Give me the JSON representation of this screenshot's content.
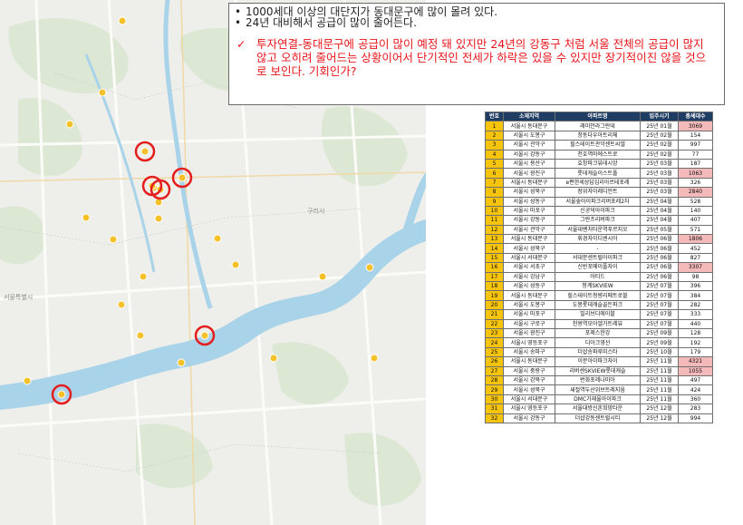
{
  "map": {
    "labels": {
      "seoul": "서울특별시",
      "guri": "구리시"
    },
    "dot_color": "#f5c12a",
    "highlight_ring_color": "#e41e1e",
    "river_color": "#a9d3e9"
  },
  "notes": {
    "bullets": [
      "1000세대 이상의 대단지가 동대문구에 많이 몰려 있다.",
      "24년 대비해서 공급이 많이 줄어든다."
    ],
    "insight": "투자연결-동대문구에 공급이 많이 예정 돼 있지만 24년의 강동구 처럼 서울 전체의 공급이 많지 않고 오히려 줄어드는 상황이어서 단기적인 전세가 하락은 있을 수 있지만 장기적이진 않을 것으로 보인다. 기회인가?",
    "insight_color": "#e8151b"
  },
  "table": {
    "columns": [
      "번호",
      "소재지역",
      "아파트명",
      "입주시기",
      "총세대수"
    ],
    "header_color": "#1f3d63",
    "number_color": "#f6c40c",
    "highlight_color": "#f4b9b9",
    "rows": [
      {
        "no": "1",
        "region": "서울시 동대문구",
        "name": "래미안라그란데",
        "date": "25년 01월",
        "units": "3069",
        "hl": true
      },
      {
        "no": "2",
        "region": "서울시 도봉구",
        "name": "창동다우아트리체",
        "date": "25년 02월",
        "units": "154",
        "hl": false
      },
      {
        "no": "3",
        "region": "서울시 관악구",
        "name": "힐스테이트관악센트씨엘",
        "date": "25년 02월",
        "units": "997",
        "hl": false
      },
      {
        "no": "4",
        "region": "서울시 강동구",
        "name": "천호역마에스트로",
        "date": "25년 02월",
        "units": "77",
        "hl": false
      },
      {
        "no": "5",
        "region": "서울시 용산구",
        "name": "효창파크뷰데시앙",
        "date": "25년 03월",
        "units": "187",
        "hl": false
      },
      {
        "no": "6",
        "region": "서울시 광진구",
        "name": "롯데캐슬이스트폴",
        "date": "25년 03월",
        "units": "1063",
        "hl": true
      },
      {
        "no": "7",
        "region": "서울시 동대문구",
        "name": "e편한세상답십리아르테포레",
        "date": "25년 03월",
        "units": "326",
        "hl": false
      },
      {
        "no": "8",
        "region": "서울시 성북구",
        "name": "장위자이레디언트",
        "date": "25년 03월",
        "units": "2840",
        "hl": true
      },
      {
        "no": "9",
        "region": "서울시 성동구",
        "name": "서울숲아이파크리버포레2차",
        "date": "25년 04월",
        "units": "528",
        "hl": false
      },
      {
        "no": "10",
        "region": "서울시 마포구",
        "name": "신공덕아이파크",
        "date": "25년 04월",
        "units": "140",
        "hl": false
      },
      {
        "no": "11",
        "region": "서울시 강동구",
        "name": "그란츠리버파크",
        "date": "25년 04월",
        "units": "407",
        "hl": false
      },
      {
        "no": "12",
        "region": "서울시 관악구",
        "name": "서울대벤처타운역푸르지오",
        "date": "25년 05월",
        "units": "571",
        "hl": false
      },
      {
        "no": "13",
        "region": "서울시 동대문구",
        "name": "휘경자이디센시아",
        "date": "25년 06월",
        "units": "1806",
        "hl": true
      },
      {
        "no": "14",
        "region": "서울시 성북구",
        "name": "-",
        "date": "25년 06월",
        "units": "452",
        "hl": false
      },
      {
        "no": "15",
        "region": "서울시 서대문구",
        "name": "서대문센트럴아이파크",
        "date": "25년 06월",
        "units": "827",
        "hl": false
      },
      {
        "no": "16",
        "region": "서울시 서초구",
        "name": "신반포메이플자이",
        "date": "25년 06월",
        "units": "3307",
        "hl": true
      },
      {
        "no": "17",
        "region": "서울시 강남구",
        "name": "아티드",
        "date": "25년 06월",
        "units": "98",
        "hl": false
      },
      {
        "no": "18",
        "region": "서울시 성동구",
        "name": "청계SKVIEW",
        "date": "25년 07월",
        "units": "396",
        "hl": false
      },
      {
        "no": "19",
        "region": "서울시 동대문구",
        "name": "힐스테이트청량리메트로블",
        "date": "25년 07월",
        "units": "384",
        "hl": false
      },
      {
        "no": "20",
        "region": "서울시 도봉구",
        "name": "도봉롯데캐슬골든파크",
        "date": "25년 07월",
        "units": "282",
        "hl": false
      },
      {
        "no": "21",
        "region": "서울시 마포구",
        "name": "빌리브디에이블",
        "date": "25년 07월",
        "units": "333",
        "hl": false
      },
      {
        "no": "22",
        "region": "서울시 구로구",
        "name": "천왕역모아엘가트레뷰",
        "date": "25년 07월",
        "units": "440",
        "hl": false
      },
      {
        "no": "23",
        "region": "서울시 광진구",
        "name": "포제스한강",
        "date": "25년 09월",
        "units": "128",
        "hl": false
      },
      {
        "no": "24",
        "region": "서울시 영등포구",
        "name": "디아크영선",
        "date": "25년 09월",
        "units": "192",
        "hl": false
      },
      {
        "no": "25",
        "region": "서울시 송파구",
        "name": "더샵송파루미스타",
        "date": "25년 10월",
        "units": "179",
        "hl": false
      },
      {
        "no": "26",
        "region": "서울시 동대문구",
        "name": "이문아이파크자이",
        "date": "25년 11월",
        "units": "4321",
        "hl": true
      },
      {
        "no": "27",
        "region": "서울시 중랑구",
        "name": "리버센SKVIEW롯데캐슬",
        "date": "25년 11월",
        "units": "1055",
        "hl": true
      },
      {
        "no": "28",
        "region": "서울시 강북구",
        "name": "번화포레나미아",
        "date": "25년 11월",
        "units": "497",
        "hl": false
      },
      {
        "no": "29",
        "region": "서울시 성북구",
        "name": "새절역두산위브트레지움",
        "date": "25년 11월",
        "units": "424",
        "hl": false
      },
      {
        "no": "30",
        "region": "서울시 서대문구",
        "name": "DMC가재울아이파크",
        "date": "25년 11월",
        "units": "360",
        "hl": false
      },
      {
        "no": "31",
        "region": "서울시 영등포구",
        "name": "서울대방신혼희망타운",
        "date": "25년 12월",
        "units": "283",
        "hl": false
      },
      {
        "no": "32",
        "region": "서울시 강동구",
        "name": "더샵강동센트럴시티",
        "date": "25년 12월",
        "units": "994",
        "hl": false
      }
    ]
  }
}
